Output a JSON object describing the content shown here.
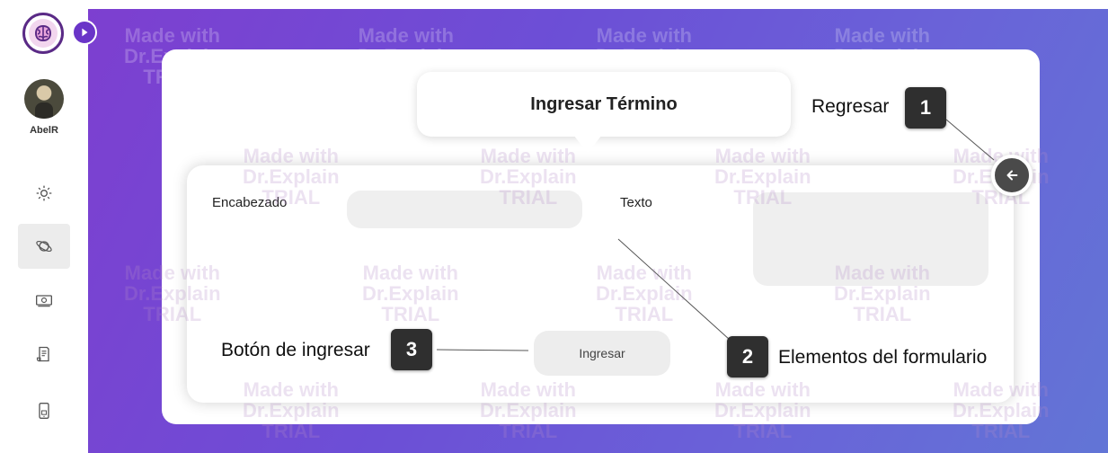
{
  "sidebar": {
    "user_name": "AbelR",
    "items": [
      {
        "icon": "gear-icon"
      },
      {
        "icon": "planet-icon",
        "active": true
      },
      {
        "icon": "money-icon"
      },
      {
        "icon": "document-icon"
      },
      {
        "icon": "phone-icon"
      }
    ]
  },
  "form": {
    "title": "Ingresar Término",
    "heading_label": "Encabezado",
    "heading_value": "",
    "text_label": "Texto",
    "text_value": "",
    "submit_label": "Ingresar"
  },
  "annotations": [
    {
      "number": "1",
      "text": "Regresar"
    },
    {
      "number": "2",
      "text": "Elementos del formulario"
    },
    {
      "number": "3",
      "text": "Botón de ingresar"
    }
  ],
  "watermark": {
    "line1": "Made with",
    "line2": "Dr.Explain",
    "line3": "TRIAL"
  },
  "colors": {
    "gradient_start": "#7d3fd0",
    "gradient_end": "#6275d6",
    "badge": "#2f2f2f",
    "logo_border": "#5a2a86"
  }
}
